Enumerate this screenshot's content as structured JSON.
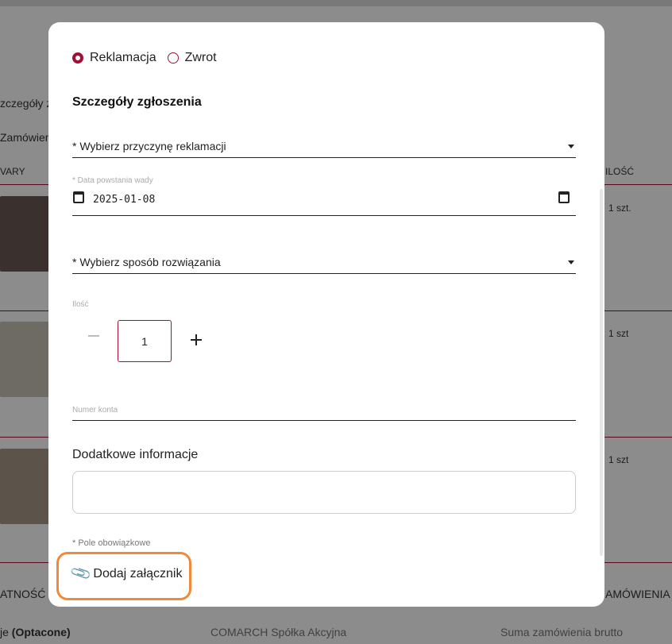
{
  "background_page": {
    "fragments": {
      "details_partial": "zczegóły za",
      "orders_partial": "Zamówien",
      "products_col_partial": "VARY",
      "qty_col": "ILOŚĆ",
      "row1_qty": "1 szt.",
      "row2_qty": "1 szt",
      "row3_qty": "1 szt",
      "payment_partial": "ATNOŚĆ I",
      "orders_sum_partial": "AMÓWIENIA",
      "optional_prefix": "je",
      "optional_label": "(Optacone)",
      "company": "COMARCH Spółka Akcyjna",
      "total_label": "Suma zamówienia brutto"
    }
  },
  "modal": {
    "type_options": [
      {
        "label": "Reklamacja",
        "selected": true
      },
      {
        "label": "Zwrot",
        "selected": false
      }
    ],
    "section_title": "Szczegóły zgłoszenia",
    "reason_select": "* Wybierz przyczynę reklamacji",
    "date_label": "* Data powstania wady",
    "date_value": "2025-01-08",
    "resolution_select": "* Wybierz sposób rozwiązania",
    "quantity_label": "Ilość",
    "quantity_value": "1",
    "account_label": "Numer konta",
    "extra_info_title": "Dodatkowe informacje",
    "required_note": "* Pole obowiązkowe",
    "attach_label": "Dodaj załącznik"
  },
  "colors": {
    "accent": "#a01032",
    "highlight": "#f0893a"
  }
}
